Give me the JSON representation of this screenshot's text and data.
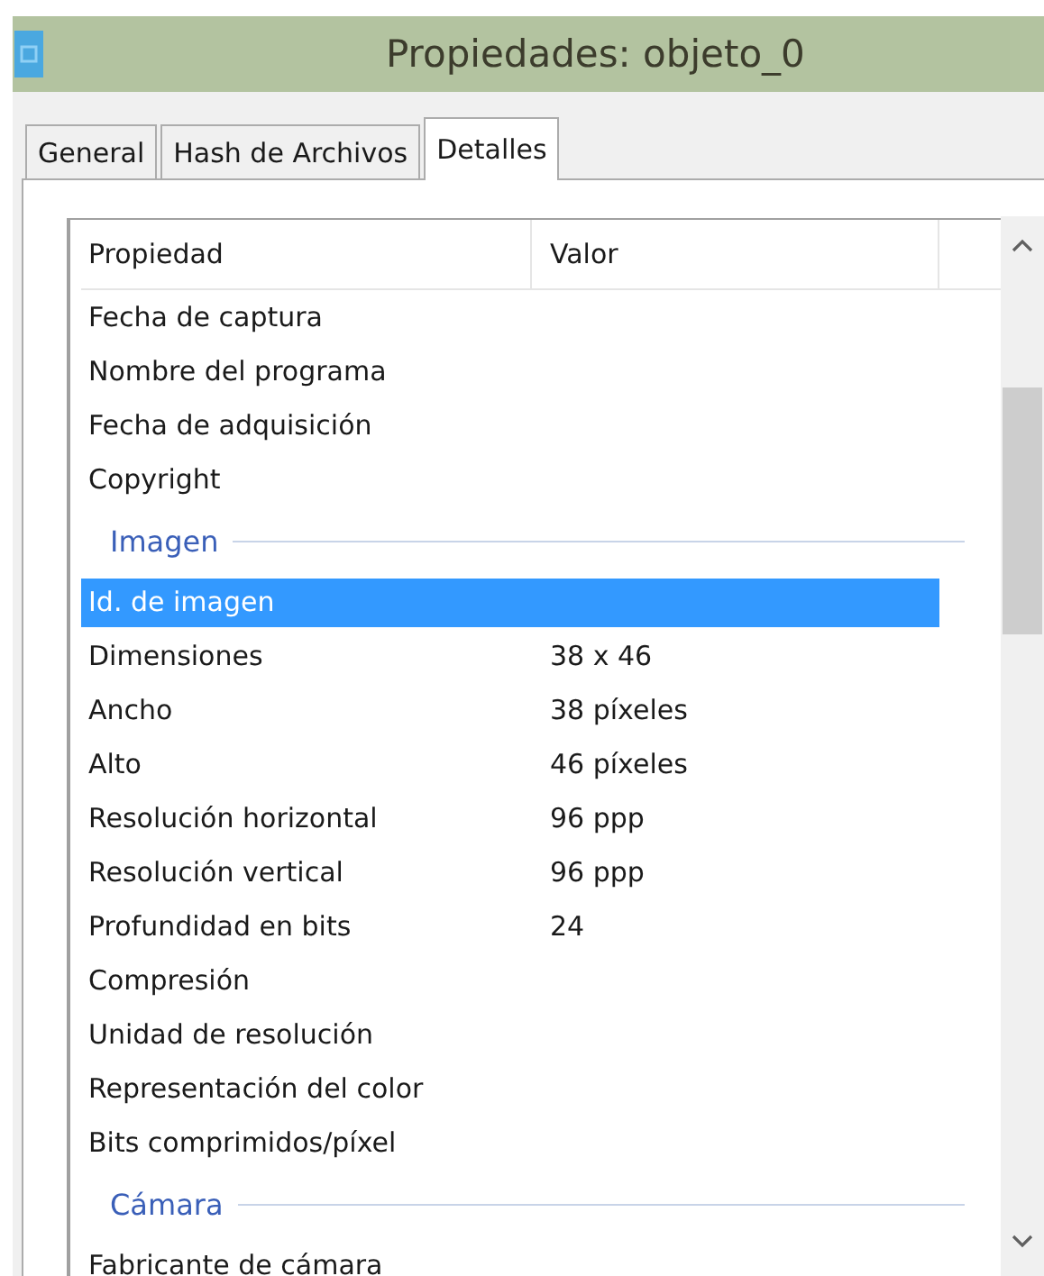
{
  "window": {
    "title": "Propiedades: objeto_0"
  },
  "tabs": [
    {
      "label": "General",
      "selected": false
    },
    {
      "label": "Hash de Archivos",
      "selected": false
    },
    {
      "label": "Detalles",
      "selected": true
    }
  ],
  "table": {
    "columns": [
      "Propiedad",
      "Valor"
    ],
    "rows": [
      {
        "kind": "row",
        "name": "Fecha de captura",
        "selected": false
      },
      {
        "kind": "row",
        "name": "Nombre del programa",
        "selected": false
      },
      {
        "kind": "row",
        "name": "Fecha de adquisición",
        "selected": false
      },
      {
        "kind": "row",
        "name": "Copyright",
        "selected": false
      },
      {
        "kind": "group",
        "name": "Imagen"
      },
      {
        "kind": "row",
        "name": "Id. de imagen",
        "selected": true
      },
      {
        "kind": "row",
        "name": "Dimensiones",
        "value": "38 x 46",
        "selected": false
      },
      {
        "kind": "row",
        "name": "Ancho",
        "value": "38 píxeles",
        "selected": false
      },
      {
        "kind": "row",
        "name": "Alto",
        "value": "46 píxeles",
        "selected": false
      },
      {
        "kind": "row",
        "name": "Resolución horizontal",
        "value": "96 ppp",
        "selected": false
      },
      {
        "kind": "row",
        "name": "Resolución vertical",
        "value": "96 ppp",
        "selected": false
      },
      {
        "kind": "row",
        "name": "Profundidad en bits",
        "value": "24",
        "selected": false
      },
      {
        "kind": "row",
        "name": "Compresión",
        "selected": false
      },
      {
        "kind": "row",
        "name": "Unidad de resolución",
        "selected": false
      },
      {
        "kind": "row",
        "name": "Representación del color",
        "selected": false
      },
      {
        "kind": "row",
        "name": "Bits comprimidos/píxel",
        "selected": false
      },
      {
        "kind": "group",
        "name": "Cámara"
      },
      {
        "kind": "row",
        "name": "Fabricante de cámara",
        "selected": false
      }
    ]
  }
}
